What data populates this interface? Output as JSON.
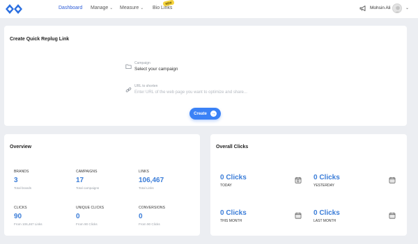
{
  "nav": {
    "items": [
      {
        "label": "Dashboard"
      },
      {
        "label": "Manage"
      },
      {
        "label": "Measure"
      },
      {
        "label": "Bio Links"
      }
    ],
    "new_badge": "NEW",
    "user_name": "Mohsin Ali"
  },
  "quick_link": {
    "title": "Create Quick Replug Link",
    "campaign_label": "Campaign",
    "campaign_value": "Select your campaign",
    "url_label": "URL to shorten",
    "url_placeholder": "Enter URL of the web page you want to optimize and share...",
    "create_label": "Create"
  },
  "overview": {
    "title": "Overview",
    "stats": [
      {
        "label": "BRANDS",
        "value": "3",
        "sub": "Total brands"
      },
      {
        "label": "CAMPAIGNS",
        "value": "17",
        "sub": "Total campaigns"
      },
      {
        "label": "LINKS",
        "value": "106,467",
        "sub": "Total Links"
      },
      {
        "label": "CLICKS",
        "value": "90",
        "sub": "From 106,467 Links"
      },
      {
        "label": "UNIQUE CLICKS",
        "value": "0",
        "sub": "From 90 Clicks"
      },
      {
        "label": "CONVERSIONS",
        "value": "0",
        "sub": "From 90 Clicks"
      }
    ]
  },
  "overall_clicks": {
    "title": "Overall Clicks",
    "items": [
      {
        "value": "0 Clicks",
        "label": "TODAY"
      },
      {
        "value": "0 Clicks",
        "label": "YESTERDAY"
      },
      {
        "value": "0 Clicks",
        "label": "THIS MONTH"
      },
      {
        "value": "0 Clicks",
        "label": "LAST MONTH"
      }
    ]
  },
  "colors": {
    "accent": "#3b82f6",
    "stat_value": "#3b7dd8",
    "nav_active": "#2b5bd7",
    "background": "#eceef2"
  }
}
